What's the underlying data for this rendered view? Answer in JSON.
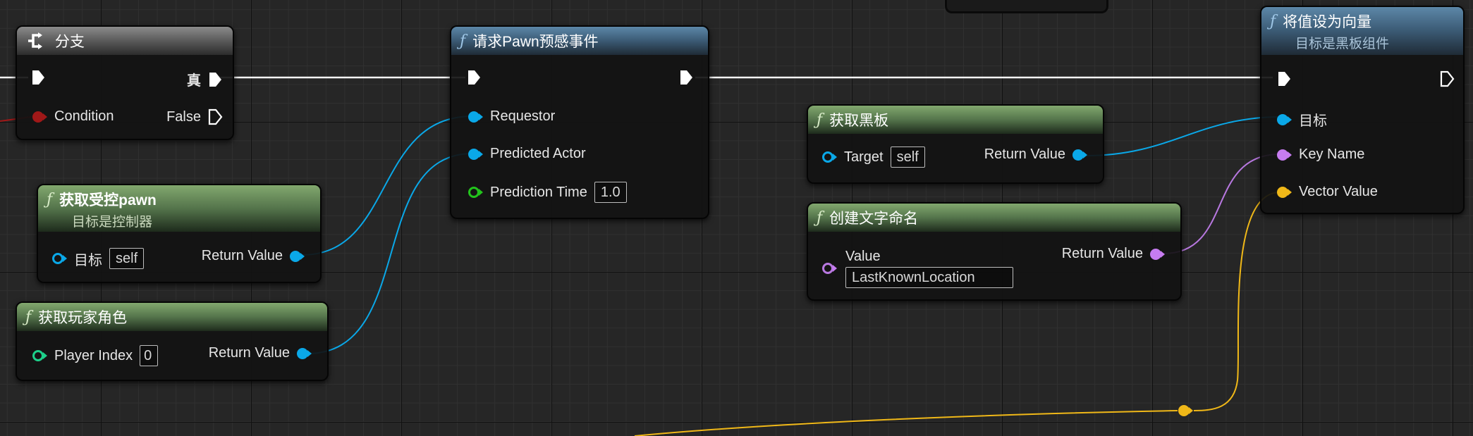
{
  "colors": {
    "exec_wire": "#ffffff",
    "object_pin": "#0aa8e8",
    "name_pin": "#c67cf0",
    "vector_pin": "#f0b818",
    "bool_pin": "#a01818",
    "int_pin": "#1dd08a",
    "float_pin": "#22c41c"
  },
  "nodes": {
    "branch": {
      "icon": "branch-icon",
      "title": "分支",
      "true_label": "真",
      "condition_label": "Condition",
      "false_label": "False"
    },
    "pawn_sensing": {
      "icon": "function-icon",
      "title": "请求Pawn预感事件",
      "requestor_label": "Requestor",
      "predicted_actor_label": "Predicted Actor",
      "prediction_time_label": "Prediction Time",
      "prediction_time_value": "1.0"
    },
    "get_blackboard": {
      "icon": "function-icon",
      "title": "获取黑板",
      "target_label": "Target",
      "target_value": "self",
      "return_label": "Return Value"
    },
    "set_value_as_vector": {
      "icon": "function-icon",
      "title": "将值设为向量",
      "subtitle": "目标是黑板组件",
      "target_label": "目标",
      "key_name_label": "Key Name",
      "vector_value_label": "Vector Value"
    },
    "get_controlled_pawn": {
      "icon": "function-icon",
      "title": "获取受控pawn",
      "subtitle": "目标是控制器",
      "target_label": "目标",
      "target_value": "self",
      "return_label": "Return Value"
    },
    "make_literal_name": {
      "icon": "function-icon",
      "title": "创建文字命名",
      "value_label": "Value",
      "value_value": "LastKnownLocation",
      "return_label": "Return Value"
    },
    "get_player_character": {
      "icon": "function-icon",
      "title": "获取玩家角色",
      "player_index_label": "Player Index",
      "player_index_value": "0",
      "return_label": "Return Value"
    }
  }
}
